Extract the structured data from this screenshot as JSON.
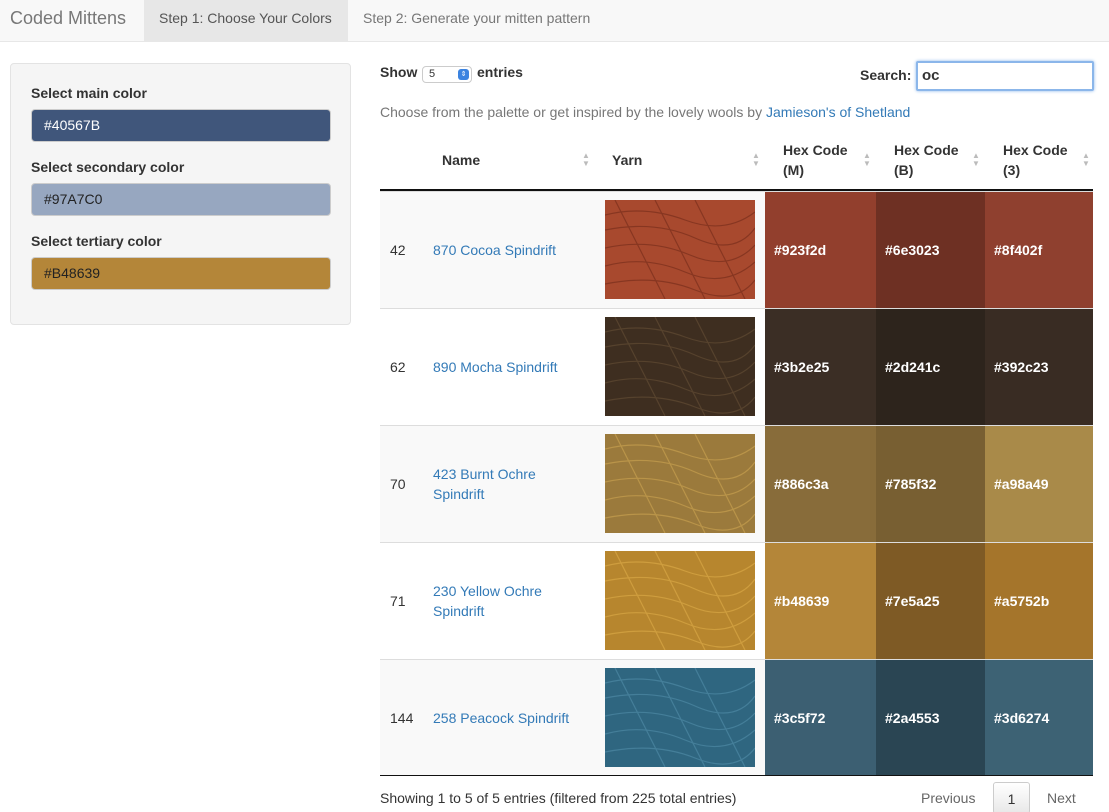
{
  "nav": {
    "brand": "Coded Mittens",
    "tabs": [
      "Step 1: Choose Your Colors",
      "Step 2: Generate your mitten pattern"
    ]
  },
  "sidebar": {
    "main_label": "Select main color",
    "main_value": "#40567B",
    "main_bg": "#40567B",
    "secondary_label": "Select secondary color",
    "secondary_value": "#97A7C0",
    "secondary_bg": "#97A7C0",
    "tertiary_label": "Select tertiary color",
    "tertiary_value": "#B48639",
    "tertiary_bg": "#B48639"
  },
  "controls": {
    "show_label": "Show",
    "length_value": "5",
    "entries_label": "entries",
    "search_label": "Search:",
    "search_value": "oc",
    "inspire_text": "Choose from the palette or get inspired by the lovely wools by",
    "inspire_link": "Jamieson's of Shetland"
  },
  "table": {
    "headers": [
      "Name",
      "Yarn",
      "Hex Code (M)",
      "Hex Code (B)",
      "Hex Code (3)"
    ],
    "header_lines": {
      "name": "Name",
      "yarn": "Yarn",
      "hm_1": "Hex Code",
      "hm_2": "(M)",
      "hb_1": "Hex Code",
      "hb_2": "(B)",
      "h3_1": "Hex Code",
      "h3_2": "(3)"
    },
    "rows": [
      {
        "idx": "42",
        "name": "870 Cocoa Spindrift",
        "m": "#923f2d",
        "b": "#6e3023",
        "t": "#8f402f"
      },
      {
        "idx": "62",
        "name": "890 Mocha Spindrift",
        "m": "#3b2e25",
        "b": "#2d241c",
        "t": "#392c23"
      },
      {
        "idx": "70",
        "name": "423 Burnt Ochre Spindrift",
        "m": "#886c3a",
        "b": "#785f32",
        "t": "#a98a49"
      },
      {
        "idx": "71",
        "name": "230 Yellow Ochre Spindrift",
        "m": "#b48639",
        "b": "#7e5a25",
        "t": "#a5752b"
      },
      {
        "idx": "144",
        "name": "258 Peacock Spindrift",
        "m": "#3c5f72",
        "b": "#2a4553",
        "t": "#3d6274"
      }
    ]
  },
  "footer": {
    "info": "Showing 1 to 5 of 5 entries (filtered from 225 total entries)",
    "previous": "Previous",
    "page": "1",
    "next": "Next"
  }
}
